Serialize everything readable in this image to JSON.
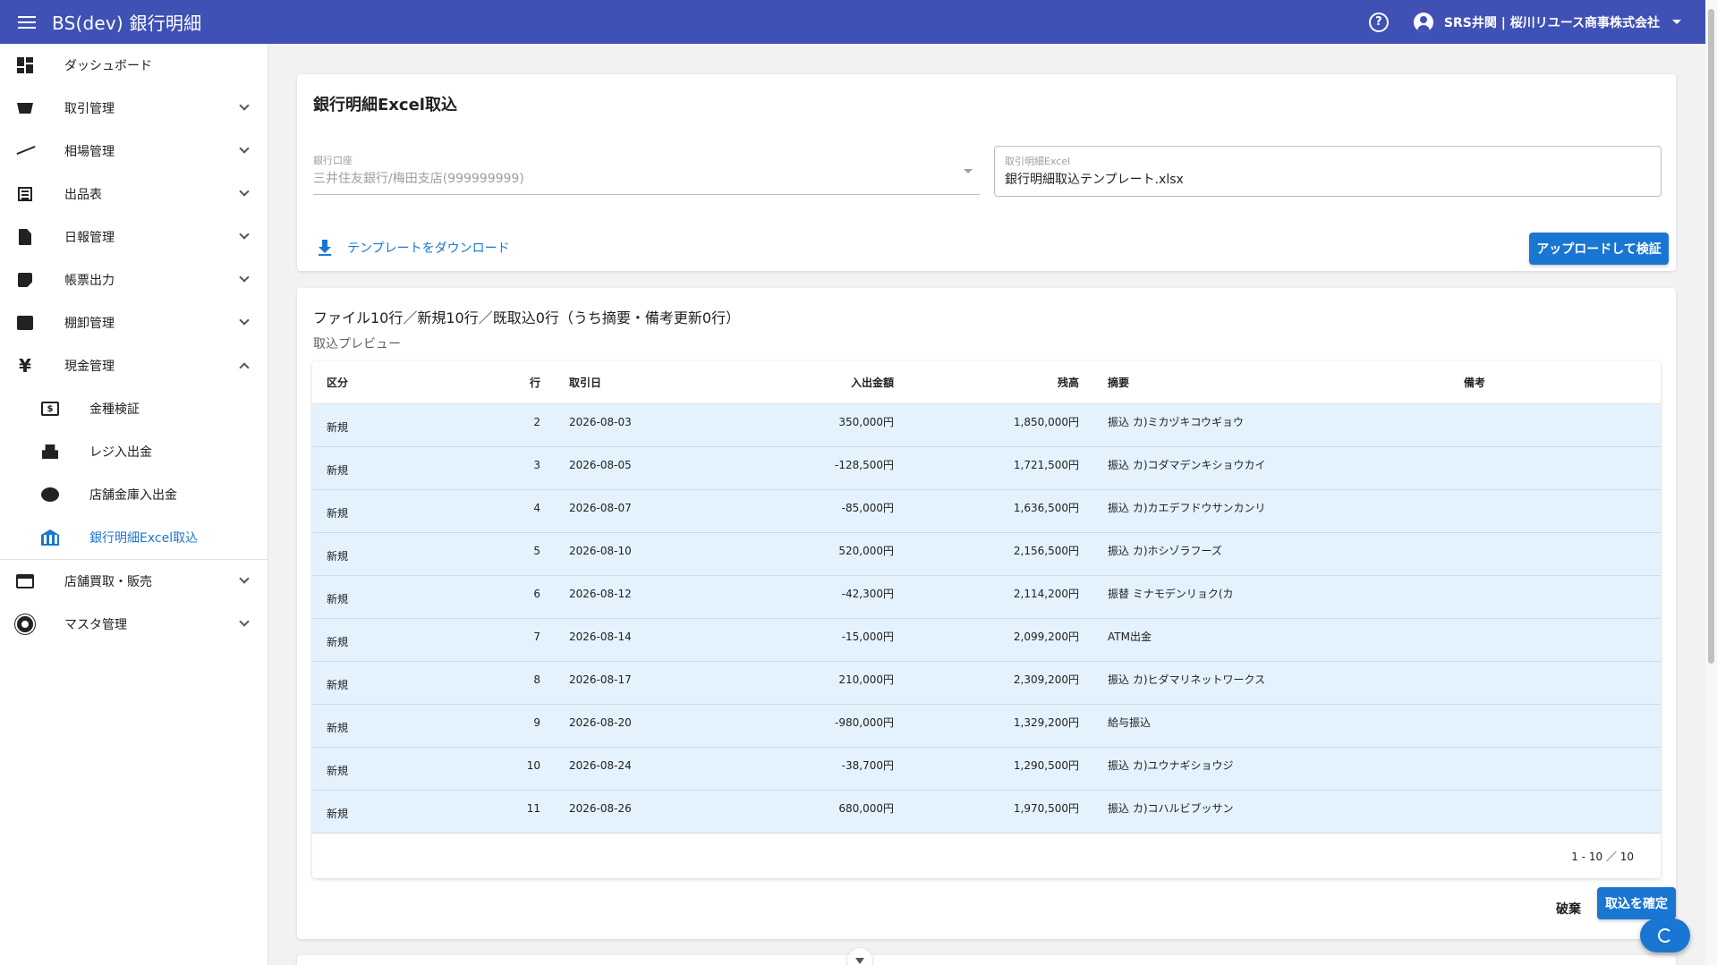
{
  "header": {
    "title": "BS(dev) 銀行明細",
    "help_symbol": "?",
    "user": "SRS井関 | 桜川リユース商事株式会社"
  },
  "sidebar": {
    "items": [
      {
        "label": "ダッシュボード",
        "icon": "dashboard-icon"
      },
      {
        "label": "取引管理",
        "icon": "cart-icon"
      },
      {
        "label": "相場管理",
        "icon": "trending-icon"
      },
      {
        "label": "出品表",
        "icon": "list-icon"
      },
      {
        "label": "日報管理",
        "icon": "document-icon"
      },
      {
        "label": "帳票出力",
        "icon": "note-icon"
      },
      {
        "label": "棚卸管理",
        "icon": "archive-icon"
      },
      {
        "label": "現金管理",
        "icon": "yen-icon"
      }
    ],
    "cash_sub": [
      {
        "label": "金種検証",
        "icon": "cash-icon"
      },
      {
        "label": "レジ入出金",
        "icon": "register-icon"
      },
      {
        "label": "店舗金庫入出金",
        "icon": "piggy-bank-icon"
      },
      {
        "label": "銀行明細Excel取込",
        "icon": "bank-icon"
      }
    ],
    "after": [
      {
        "label": "店舗買取・販売",
        "icon": "store-icon"
      },
      {
        "label": "マスタ管理",
        "icon": "gear-icon"
      }
    ],
    "yen_symbol": "¥",
    "cash_symbol": "$"
  },
  "import_card": {
    "title": "銀行明細Excel取込",
    "account_label": "銀行口座",
    "account_value": "三井住友銀行/梅田支店(999999999)",
    "file_label": "取引明細Excel",
    "file_value": "銀行明細取込テンプレート.xlsx",
    "download_label": "テンプレートをダウンロード",
    "upload_label": "アップロードして検証"
  },
  "preview_card": {
    "summary": "ファイル10行／新規10行／既取込0行（うち摘要・備考更新0行）",
    "preview_label": "取込プレビュー",
    "columns": {
      "kubun": "区分",
      "row": "行",
      "date": "取引日",
      "amount": "入出金額",
      "balance": "残高",
      "desc": "摘要",
      "note": "備考"
    },
    "rows": [
      {
        "kubun": "新規",
        "row": "2",
        "date": "2026-08-03",
        "amount": "350,000円",
        "balance": "1,850,000円",
        "desc": "振込 カ)ミカヅキコウギョウ",
        "note": ""
      },
      {
        "kubun": "新規",
        "row": "3",
        "date": "2026-08-05",
        "amount": "-128,500円",
        "balance": "1,721,500円",
        "desc": "振込 カ)コダマデンキショウカイ",
        "note": ""
      },
      {
        "kubun": "新規",
        "row": "4",
        "date": "2026-08-07",
        "amount": "-85,000円",
        "balance": "1,636,500円",
        "desc": "振込 カ)カエデフドウサンカンリ",
        "note": ""
      },
      {
        "kubun": "新規",
        "row": "5",
        "date": "2026-08-10",
        "amount": "520,000円",
        "balance": "2,156,500円",
        "desc": "振込 カ)ホシゾラフーズ",
        "note": ""
      },
      {
        "kubun": "新規",
        "row": "6",
        "date": "2026-08-12",
        "amount": "-42,300円",
        "balance": "2,114,200円",
        "desc": "振替 ミナモデンリョク(カ",
        "note": ""
      },
      {
        "kubun": "新規",
        "row": "7",
        "date": "2026-08-14",
        "amount": "-15,000円",
        "balance": "2,099,200円",
        "desc": "ATM出金",
        "note": ""
      },
      {
        "kubun": "新規",
        "row": "8",
        "date": "2026-08-17",
        "amount": "210,000円",
        "balance": "2,309,200円",
        "desc": "振込 カ)ヒダマリネットワークス",
        "note": ""
      },
      {
        "kubun": "新規",
        "row": "9",
        "date": "2026-08-20",
        "amount": "-980,000円",
        "balance": "1,329,200円",
        "desc": "給与振込",
        "note": ""
      },
      {
        "kubun": "新規",
        "row": "10",
        "date": "2026-08-24",
        "amount": "-38,700円",
        "balance": "1,290,500円",
        "desc": "振込 カ)ユウナギショウジ",
        "note": ""
      },
      {
        "kubun": "新規",
        "row": "11",
        "date": "2026-08-26",
        "amount": "680,000円",
        "balance": "1,970,500円",
        "desc": "振込 カ)コハルビブッサン",
        "note": ""
      }
    ],
    "pager": "1 - 10 ／ 10",
    "discard_label": "破棄",
    "confirm_label": "取込を確定"
  },
  "colors": {
    "appbar": "#3f51b5",
    "primary": "#1976d2",
    "row_highlight": "#e3f2fd"
  }
}
